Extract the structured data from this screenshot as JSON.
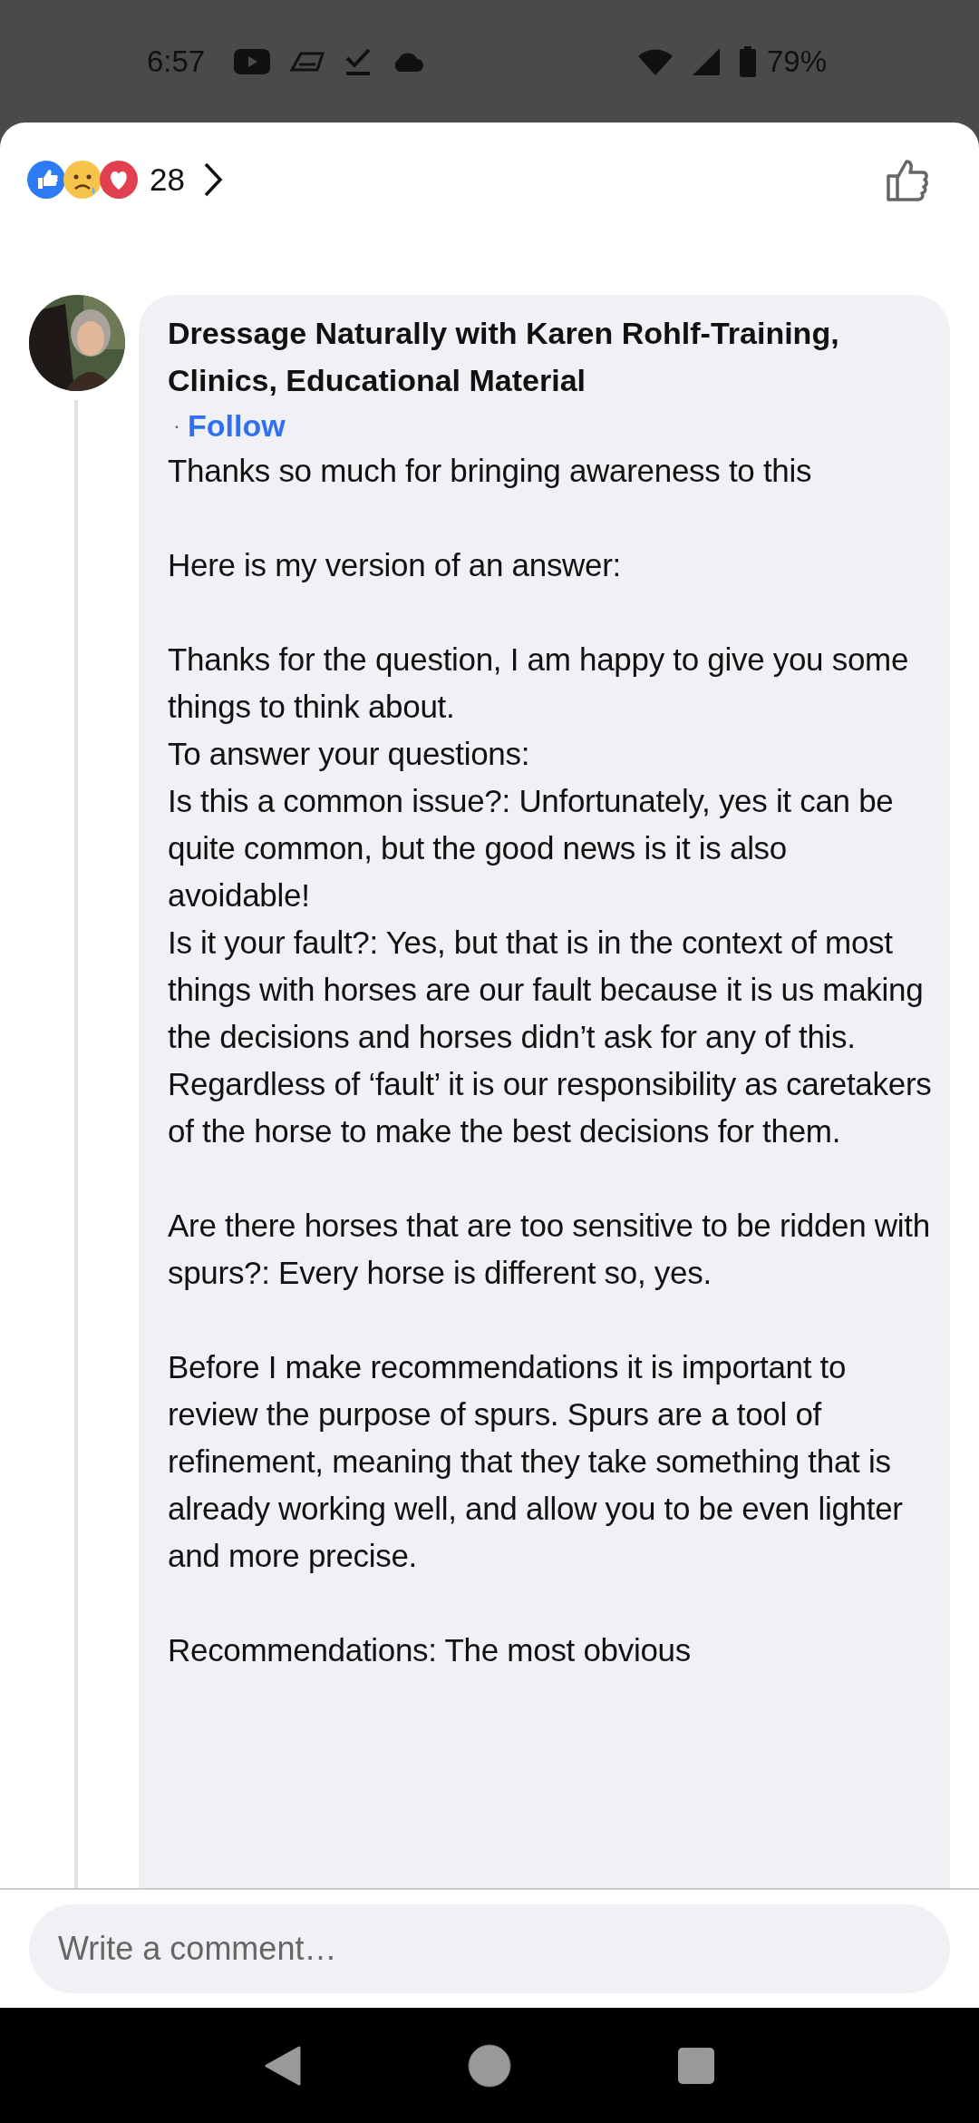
{
  "status_bar": {
    "time": "6:57",
    "battery": "79%"
  },
  "reactions": {
    "count": "28"
  },
  "comment": {
    "author": "Dressage Naturally with Karen Rohlf-Training, Clinics, Educational Material",
    "separator": "·",
    "follow": "Follow",
    "paragraphs": [
      [
        "Thanks so much for bringing awareness to this"
      ],
      [
        "Here is my version of an answer:"
      ],
      [
        "Thanks for the question, I am happy to give you some things to think about.",
        "To answer your questions:",
        "Is this a common issue?: Unfortunately, yes it can be quite common, but the good news is it is also avoidable!",
        "Is it your fault?: Yes, but that is in the context of most things with horses are our fault because it is us making the decisions and horses didn’t ask for any of this. Regardless of ‘fault’ it is our responsibility as caretakers of the horse to make the best decisions for them."
      ],
      [
        "Are there horses that are too sensitive to be ridden with spurs?: Every horse is different so, yes."
      ],
      [
        "Before I make recommendations it is important to review the purpose of spurs. Spurs are a tool of refinement, meaning that they take something that is already working well, and allow you to be even lighter and more precise."
      ],
      [
        "Recommendations: The most obvious"
      ]
    ]
  },
  "composer": {
    "placeholder": "Write a comment…"
  }
}
